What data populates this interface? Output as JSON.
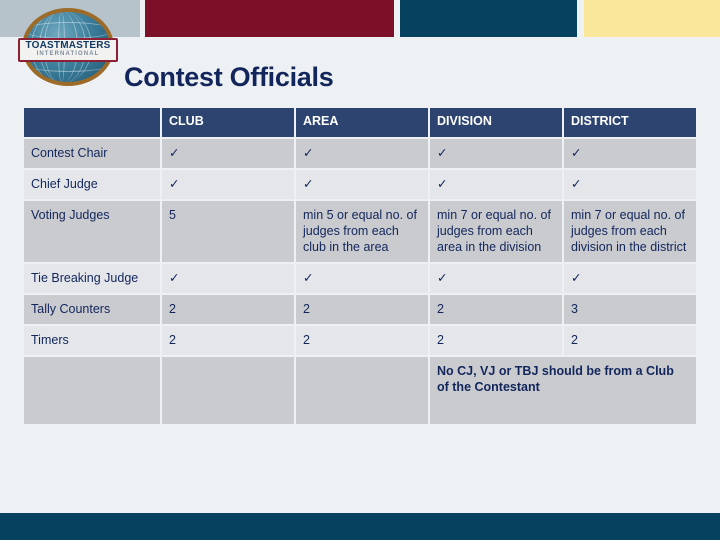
{
  "header": {
    "bands": [
      {
        "name": "gray",
        "color": "#b7c3ca"
      },
      {
        "name": "maroon",
        "color": "#7c1029"
      },
      {
        "name": "navy",
        "color": "#06415f"
      },
      {
        "name": "yellow",
        "color": "#fbe79b"
      }
    ],
    "logo": {
      "line1": "TOASTMASTERS",
      "line2": "INTERNATIONAL"
    },
    "title": "Contest Officials"
  },
  "table": {
    "columns": [
      "",
      "CLUB",
      "AREA",
      "DIVISION",
      "DISTRICT"
    ],
    "rows": [
      {
        "label": "Contest Chair",
        "cells": [
          "✓",
          "✓",
          "✓",
          "✓"
        ]
      },
      {
        "label": "Chief Judge",
        "cells": [
          "✓",
          "✓",
          "✓",
          "✓"
        ]
      },
      {
        "label": "Voting Judges",
        "cells": [
          "5",
          "min 5 or equal no. of judges from each club in the area",
          "min 7 or equal no. of judges from each area in the division",
          "min 7 or equal no. of judges from each division in the district"
        ]
      },
      {
        "label": "Tie Breaking Judge",
        "cells": [
          "✓",
          "✓",
          "✓",
          "✓"
        ]
      },
      {
        "label": "Tally Counters",
        "cells": [
          "2",
          "2",
          "2",
          "3"
        ]
      },
      {
        "label": "Timers",
        "cells": [
          "2",
          "2",
          "2",
          "2"
        ]
      }
    ],
    "footer_note": "No CJ, VJ or TBJ should be from a Club of the Contestant",
    "note_color": "#d81f26"
  },
  "footer": {
    "bar_color": "#06415f"
  }
}
